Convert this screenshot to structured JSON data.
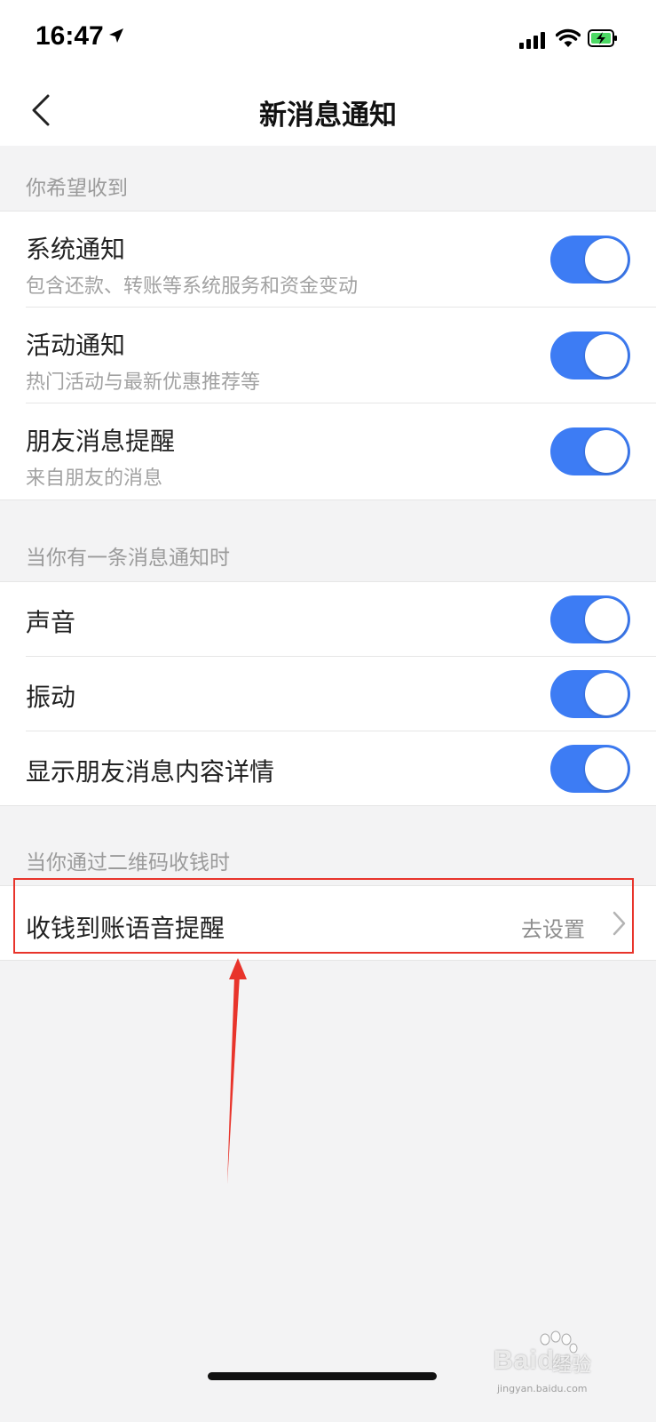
{
  "status_bar": {
    "time": "16:47"
  },
  "nav": {
    "title": "新消息通知"
  },
  "sections": [
    {
      "header": "你希望收到",
      "items": [
        {
          "title": "系统通知",
          "subtitle": "包含还款、转账等系统服务和资金变动",
          "enabled": true
        },
        {
          "title": "活动通知",
          "subtitle": "热门活动与最新优惠推荐等",
          "enabled": true
        },
        {
          "title": "朋友消息提醒",
          "subtitle": "来自朋友的消息",
          "enabled": true
        }
      ]
    },
    {
      "header": "当你有一条消息通知时",
      "items": [
        {
          "title": "声音",
          "enabled": true
        },
        {
          "title": "振动",
          "enabled": true
        },
        {
          "title": "显示朋友消息内容详情",
          "enabled": true
        }
      ]
    },
    {
      "header": "当你通过二维码收钱时",
      "items": [
        {
          "title": "收钱到账语音提醒",
          "action": "去设置"
        }
      ]
    }
  ],
  "watermark": {
    "brand": "Baidu",
    "suffix": "经验",
    "url": "jingyan.baidu.com"
  },
  "colors": {
    "toggle_on": "#3d7cf4",
    "highlight": "#e8342b",
    "background": "#f3f3f4"
  }
}
